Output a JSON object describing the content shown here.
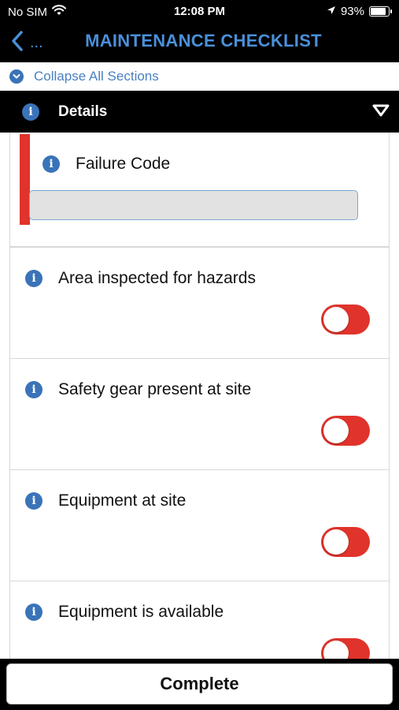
{
  "status_bar": {
    "carrier": "No SIM",
    "time": "12:08 PM",
    "battery": "93%"
  },
  "nav": {
    "back_label": "...",
    "title": "MAINTENANCE CHECKLIST"
  },
  "collapse": {
    "label": "Collapse All Sections"
  },
  "section": {
    "title": "Details"
  },
  "failure_code": {
    "label": "Failure Code",
    "value": ""
  },
  "items": [
    {
      "label": "Area inspected for hazards",
      "toggle_on": false
    },
    {
      "label": "Safety gear present at site",
      "toggle_on": false
    },
    {
      "label": "Equipment at site",
      "toggle_on": false
    },
    {
      "label": "Equipment is available",
      "toggle_on": false
    }
  ],
  "footer": {
    "complete_label": "Complete"
  },
  "colors": {
    "accent": "#4a90d9",
    "info": "#3a73b8",
    "required": "#e0332b",
    "toggle_off": "#e0332b"
  }
}
